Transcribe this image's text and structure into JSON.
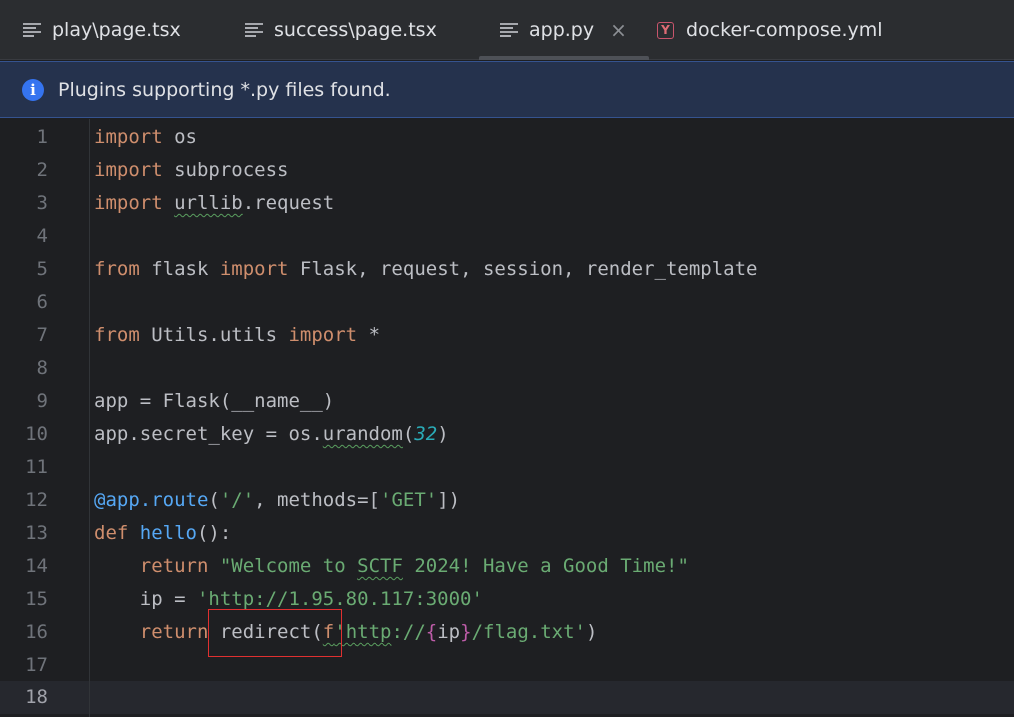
{
  "tabs": [
    {
      "label": "play\\page.tsx",
      "icon": "text-file-icon"
    },
    {
      "label": "success\\page.tsx",
      "icon": "text-file-icon"
    },
    {
      "label": "app.py",
      "icon": "text-file-icon",
      "active": true,
      "close": "×"
    },
    {
      "label": "docker-compose.yml",
      "icon": "yaml-file-icon",
      "icon_text": "Y"
    }
  ],
  "banner": {
    "icon": "info-icon",
    "icon_text": "i",
    "text": "Plugins supporting *.py files found."
  },
  "editor": {
    "line_numbers": [
      "1",
      "2",
      "3",
      "4",
      "5",
      "6",
      "7",
      "8",
      "9",
      "10",
      "11",
      "12",
      "13",
      "14",
      "15",
      "16",
      "17",
      "18"
    ],
    "current_line": 18,
    "lines": [
      "import os",
      "import subprocess",
      "import urllib.request",
      "",
      "from flask import Flask, request, session, render_template",
      "",
      "from Utils.utils import *",
      "",
      "app = Flask(__name__)",
      "app.secret_key = os.urandom(32)",
      "",
      "@app.route('/', methods=['GET'])",
      "def hello():",
      "    return \"Welcome to SCTF 2024! Have a Good Time!\"",
      "    ip = 'http://1.95.80.117:3000'",
      "    return redirect(f'http://{ip}/flag.txt')",
      "",
      ""
    ]
  },
  "colors": {
    "keyword": "#cf8e6d",
    "string": "#6aab73",
    "number": "#2aacb8",
    "decorator": "#56a8f5",
    "highlight_box": "#e03030",
    "banner_bg": "#25324d"
  }
}
